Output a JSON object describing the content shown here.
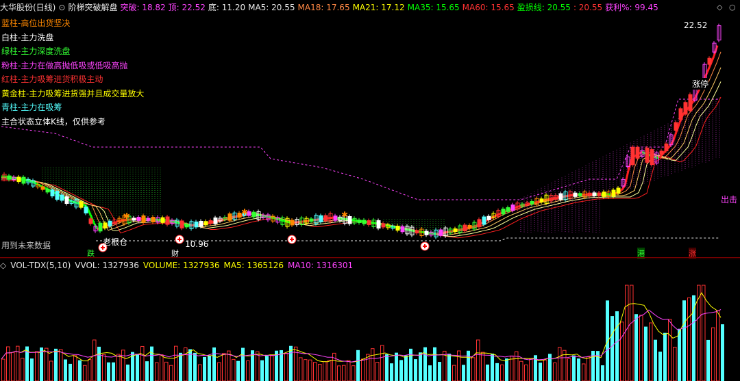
{
  "header": {
    "stock": "大华股份(日线)",
    "indicator_name": "阶梯突破解盘",
    "tupo": "突破: 18.82",
    "ding": "顶: 22.52",
    "di": "底: 11.20",
    "ma5": "MA5: 20.55",
    "ma18": "MA18: 17.65",
    "ma21": "MA21: 17.12",
    "ma35": "MA35: 15.65",
    "ma60": "MA60: 15.65",
    "yingsun": "盈损线: 20.55",
    "yingsun2": ": 20.55",
    "huoli": "获利%: 99.45"
  },
  "legend": {
    "blue": "蓝柱-高位出货坚决",
    "white": "白柱-主力洗盘",
    "green": "绿柱-主力深度洗盘",
    "pink": "粉柱-主力在做高抛低吸或低吸高抛",
    "red": "红柱-主力吸筹进货积极主动",
    "gold": "黄金柱-主力吸筹进货强并且成交量放大",
    "cyan": "青柱-主力在吸筹",
    "note": "主合状态立体K线，仅供参考"
  },
  "chart_labels": {
    "future_data": "用到未来数据",
    "old_position": "老根仓",
    "low_price": "10.96",
    "high_price": "22.52",
    "exit": "出击",
    "limit_up": "涨停",
    "die": "跌",
    "cai": "财",
    "gang": "港",
    "zhang": "涨"
  },
  "volume_header": {
    "name": "VOL-TDX(5,10)",
    "vvol": "VVOL: 1327936",
    "volume": "VOLUME: 1327936",
    "ma5": "MA5: 1365126",
    "ma10": "MA10: 1316301"
  },
  "colors": {
    "up": "#ff3232",
    "down": "#54ffff",
    "ma_red": "#ff2020",
    "ma_yellow": "#ffff00",
    "ma_pink": "#ff44ff",
    "ma_green": "#00ff00"
  }
}
